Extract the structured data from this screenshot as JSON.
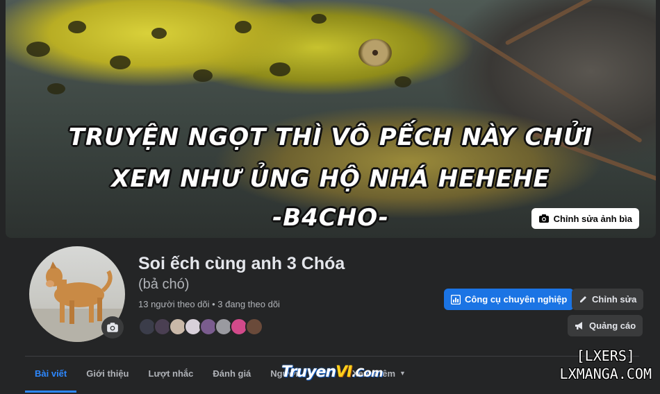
{
  "cover": {
    "caption_lines": [
      "TRUYỆN NGỌT THÌ VÔ PẾCH NÀY CHỬI",
      "XEM NHƯ ỦNG HỘ NHÁ HEHEHE",
      "-B4CHO-"
    ],
    "edit_button_label": "Chỉnh sửa ảnh bìa",
    "edit_button_icon": "camera-icon"
  },
  "profile": {
    "name": "Soi ếch cùng anh 3 Chóa",
    "alternate_name": "(bả chó)",
    "followers_text": "13 người theo dõi • 3 đang theo dõi",
    "friend_avatar_colors": [
      "#3b3d4a",
      "#4a3f52",
      "#c9b8a8",
      "#d8d0da",
      "#7a5c8e",
      "#9a9aa0",
      "#d24a8a",
      "#6a4a3a"
    ]
  },
  "actions": {
    "pro_tools_label": "Công cụ chuyên nghiệp",
    "edit_label": "Chỉnh sửa",
    "ads_label": "Quảng cáo"
  },
  "tabs": [
    {
      "label": "Bài viết",
      "active": true
    },
    {
      "label": "Giới thiệu",
      "active": false
    },
    {
      "label": "Lượt nhắc",
      "active": false
    },
    {
      "label": "Đánh giá",
      "active": false
    },
    {
      "label": "Người",
      "active": false
    },
    {
      "label": "Xem thêm",
      "active": false
    }
  ],
  "watermarks": {
    "truyenvi_part1": "Truyen",
    "truyenvi_part2": "VI",
    "truyenvi_part3": ".Com",
    "lxmanga_line1": "[LXERS]",
    "lxmanga_line2": "LXMANGA.COM"
  },
  "colors": {
    "background": "#242526",
    "accent": "#1b74e4",
    "active_tab": "#2d88ff",
    "secondary_button": "#3a3b3c"
  }
}
